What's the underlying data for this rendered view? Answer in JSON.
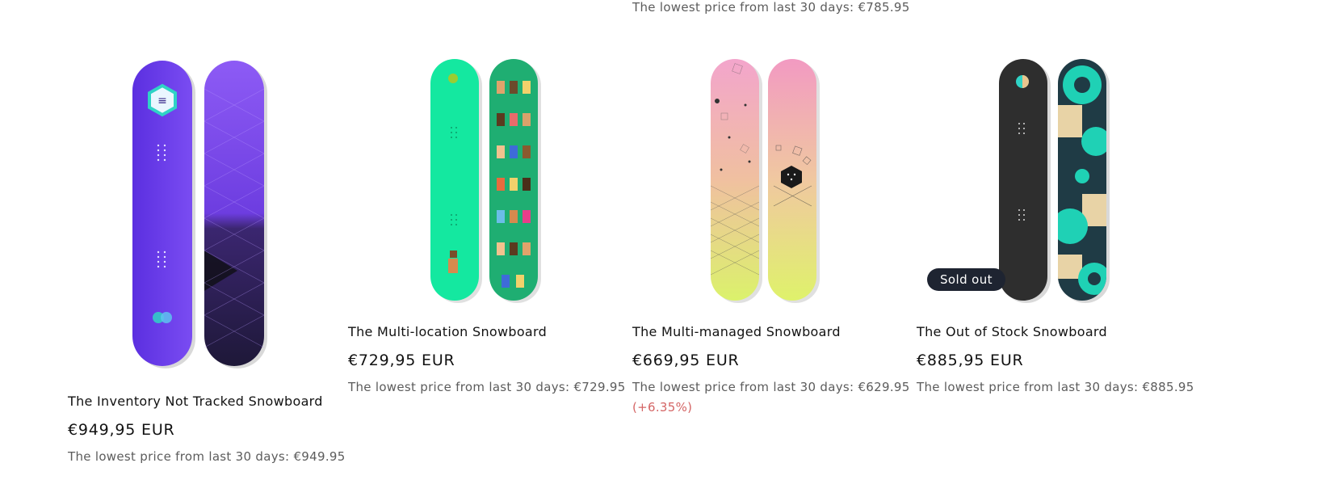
{
  "top_line": "The lowest price from last 30 days: €785.95",
  "products": [
    {
      "title": "The Inventory Not Tracked Snowboard",
      "price": "€949,95 EUR",
      "lowest_price": "The lowest price from last 30 days: €949.95",
      "colors": {
        "base": "#6a3ee8",
        "secondary": "#3e2a77",
        "accent": "#2fd3c6"
      }
    },
    {
      "title": "The Multi-location Snowboard",
      "price": "€729,95 EUR",
      "lowest_price": "The lowest price from last 30 days: €729.95",
      "colors": {
        "base": "#14e8a0",
        "secondary": "#1fae72"
      }
    },
    {
      "title": "The Multi-managed Snowboard",
      "price": "€669,95 EUR",
      "lowest_price": "The lowest price from last 30 days: €629.95",
      "price_change": "(+6.35%)",
      "colors": {
        "base": "#f2a3c7",
        "secondary": "#dff26b"
      }
    },
    {
      "title": "The Out of Stock Snowboard",
      "price": "€885,95 EUR",
      "lowest_price": "The lowest price from last 30 days: €885.95",
      "badge": "Sold out",
      "colors": {
        "base": "#2e2e2e",
        "secondary": "#1f3b45",
        "accent": "#1fd1b5"
      }
    }
  ]
}
